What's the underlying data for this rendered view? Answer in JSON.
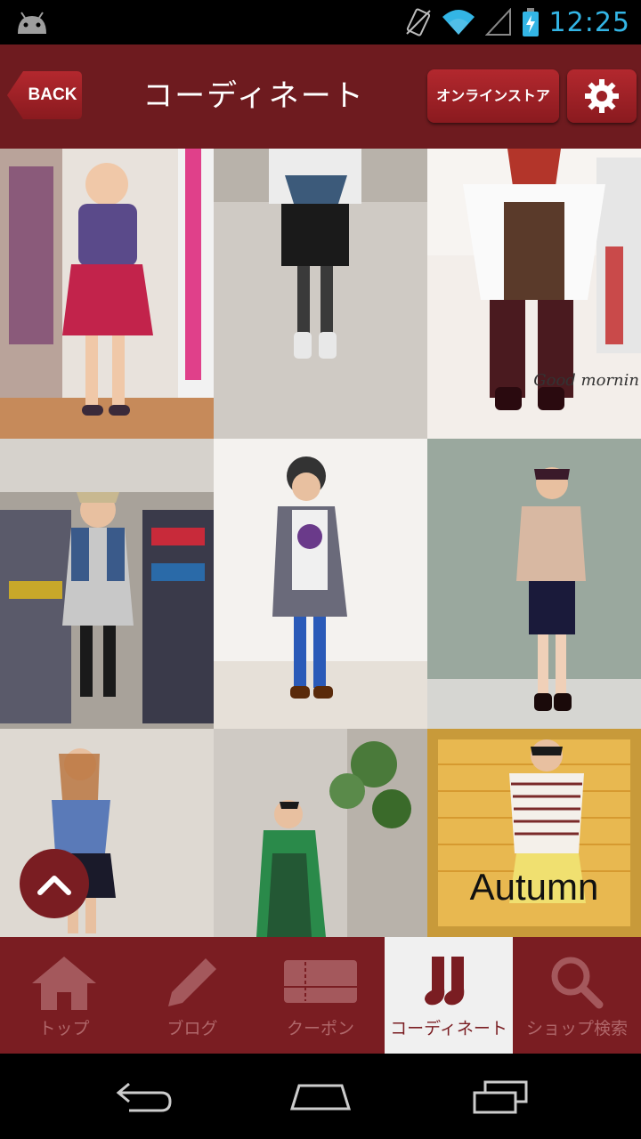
{
  "status_bar": {
    "time": "12:25",
    "icons": [
      "android-icon",
      "vibrate-icon",
      "wifi-icon",
      "signal-icon",
      "battery-charging-icon"
    ]
  },
  "header": {
    "back_label": "BACK",
    "title": "コーディネート",
    "store_label": "オンラインストア",
    "settings_icon": "gear-icon"
  },
  "grid": {
    "tiles": [
      {
        "id": 1,
        "caption": ""
      },
      {
        "id": 2,
        "caption": ""
      },
      {
        "id": 3,
        "caption": "Good mornin"
      },
      {
        "id": 4,
        "caption": ""
      },
      {
        "id": 5,
        "caption": ""
      },
      {
        "id": 6,
        "caption": ""
      },
      {
        "id": 7,
        "caption": ""
      },
      {
        "id": 8,
        "caption": ""
      },
      {
        "id": 9,
        "caption": "Autumn"
      }
    ]
  },
  "tabs": [
    {
      "label": "トップ",
      "icon": "home-icon",
      "active": false
    },
    {
      "label": "ブログ",
      "icon": "pencil-icon",
      "active": false
    },
    {
      "label": "クーポン",
      "icon": "coupon-icon",
      "active": false
    },
    {
      "label": "コーディネート",
      "icon": "socks-icon",
      "active": true
    },
    {
      "label": "ショップ検索",
      "icon": "search-icon",
      "active": false
    }
  ],
  "colors": {
    "header_bg": "#6e1b1f",
    "tab_bg": "#7a1d22",
    "accent_time": "#33b5e5"
  }
}
